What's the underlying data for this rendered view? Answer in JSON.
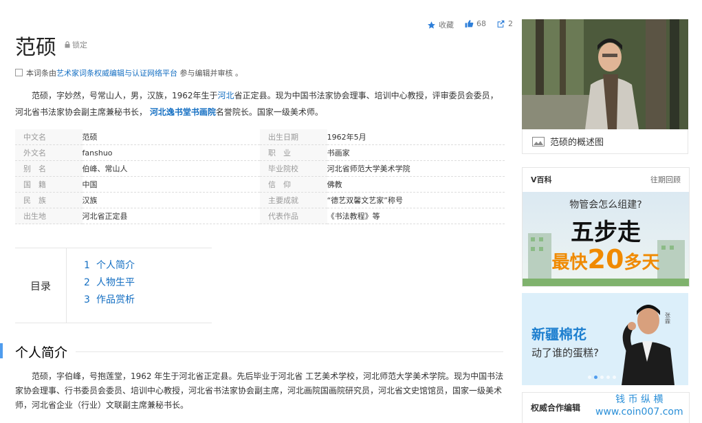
{
  "entry": {
    "title": "范硕",
    "lock_label": "锁定",
    "actions": {
      "favorite_label": "收藏",
      "like_count": "68",
      "share_count": "2"
    },
    "notice": {
      "prefix": "本词条由",
      "link": "艺术家词条权威编辑与认证网络平台",
      "suffix": "参与编辑并审核 。"
    },
    "intro": {
      "p1": "范硕，字妙然，号常山人，男，汉族，1962年生于",
      "link1": "河北",
      "p2": "省正定县。现为中国书法家协会理事、培训中心教授，评审委员会委员，河北省书法家协会副主席兼秘书长，",
      "link2": "河北逸书堂书画院",
      "p3": "名誉院长。国家一级美术师。"
    }
  },
  "basic_info": [
    {
      "k1": "中文名",
      "v1": "范硕",
      "k2": "出生日期",
      "v2": "1962年5月"
    },
    {
      "k1": "外文名",
      "v1": "fanshuo",
      "k2": "职　业",
      "v2": "书画家"
    },
    {
      "k1": "别　名",
      "v1": "伯峰、常山人",
      "k2": "毕业院校",
      "v2": "河北省师范大学美术学院"
    },
    {
      "k1": "国　籍",
      "v1": "中国",
      "k2": "信　仰",
      "v2": "佛教"
    },
    {
      "k1": "民　族",
      "v1": "汉族",
      "k2": "主要成就",
      "v2": "“德艺双馨文艺家”称号"
    },
    {
      "k1": "出生地",
      "v1": "河北省正定县",
      "k2": "代表作品",
      "v2": "《书法教程》等"
    }
  ],
  "toc": {
    "label": "目录",
    "items": [
      {
        "num": "1",
        "label": "个人简介"
      },
      {
        "num": "2",
        "label": "人物生平"
      },
      {
        "num": "3",
        "label": "作品赏析"
      }
    ]
  },
  "section1": {
    "heading": "个人简介",
    "text": "范硕，字伯峰，号抱莲堂，1962 年生于河北省正定县。先后毕业于河北省 工艺美术学校，河北师范大学美术学院。现为中国书法家协会理事、行书委员会委员、培训中心教授，河北省书法家协会副主席，河北画院国画院研究员，河北省文史馆馆员，国家一级美术师，河北省企业（行业）文联副主席兼秘书长。"
  },
  "sidebar": {
    "photo_caption": "范硕的概述图",
    "vbaike": {
      "title": "V百科",
      "more": "往期回顾"
    },
    "banner1": {
      "question": "物管会怎么组建?",
      "big": "五步走",
      "sub_prefix": "最快",
      "sub_num": "20",
      "sub_suffix": "多天"
    },
    "banner2": {
      "line1": "新疆棉花",
      "line2": "动了谁的蛋糕?",
      "tag": "张霖"
    },
    "coop_title": "权威合作编辑"
  },
  "watermark": {
    "line1": "钱 币 纵 横",
    "line2": "www.coin007.com"
  },
  "colors": {
    "link": "#136ec2",
    "accent": "#4f9cee",
    "banner_orange": "#f08a00"
  }
}
